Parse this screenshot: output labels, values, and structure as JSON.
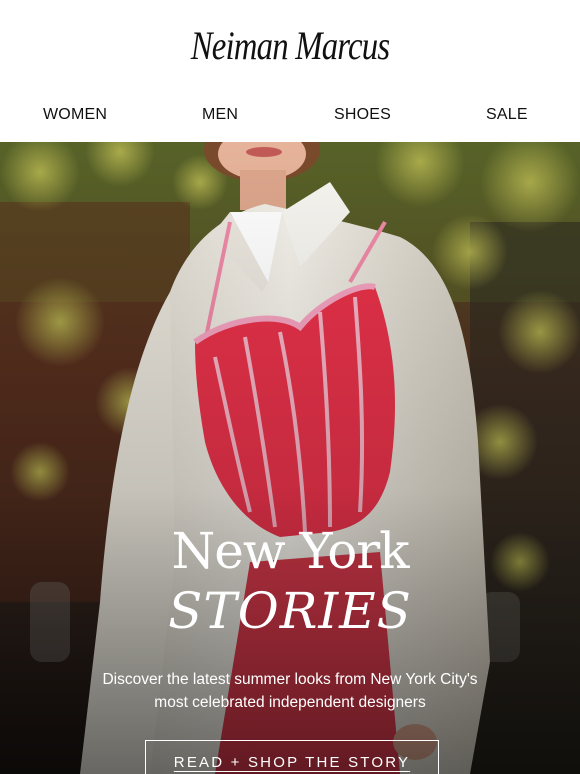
{
  "header": {
    "logo": "Neiman Marcus"
  },
  "nav": {
    "items": [
      "WOMEN",
      "MEN",
      "SHOES",
      "SALE"
    ]
  },
  "hero": {
    "title_line1": "New York",
    "title_line2": "STORIES",
    "description_line1": "Discover the latest summer looks from New York City's",
    "description_line2": "most celebrated independent designers",
    "cta_label": "READ + SHOP THE STORY"
  },
  "colors": {
    "accent_red": "#e8324a",
    "shirt_white": "#f2efe8",
    "foliage": "#6f7a2a",
    "background_dark": "#2a1d16"
  }
}
